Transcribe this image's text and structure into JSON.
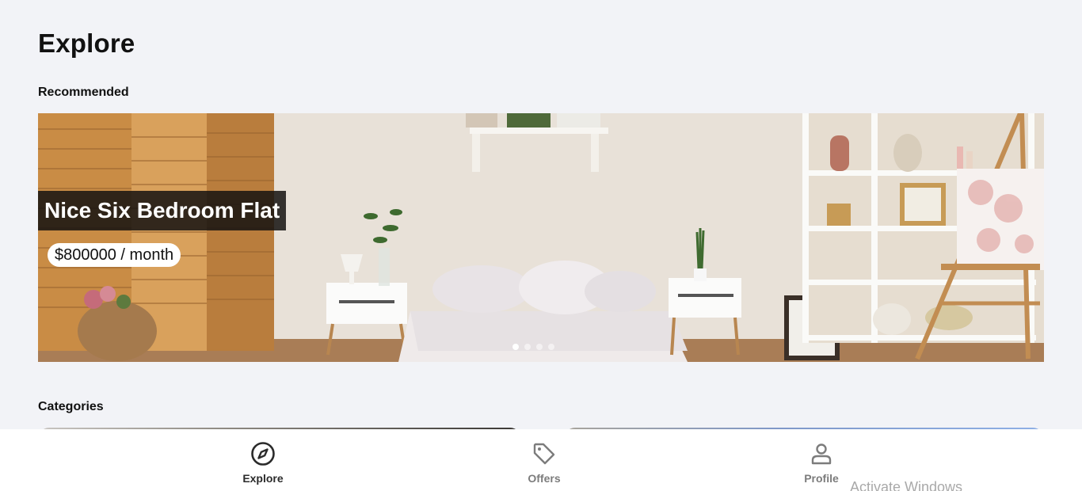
{
  "header": {
    "title": "Explore"
  },
  "recommended": {
    "label": "Recommended",
    "banner": {
      "title": "Nice Six Bedroom Flat",
      "price": "$800000 / month",
      "slides_total": 4,
      "active_slide": 1
    }
  },
  "categories": {
    "label": "Categories"
  },
  "bottom_nav": {
    "items": [
      {
        "label": "Explore",
        "icon": "compass-icon",
        "active": true
      },
      {
        "label": "Offers",
        "icon": "tag-icon",
        "active": false
      },
      {
        "label": "Profile",
        "icon": "user-icon",
        "active": false
      }
    ]
  },
  "watermark": "Activate Windows",
  "colors": {
    "background": "#f2f3f7",
    "nav_active": "#2b2b2b",
    "nav_inactive": "#7c7c7c"
  }
}
